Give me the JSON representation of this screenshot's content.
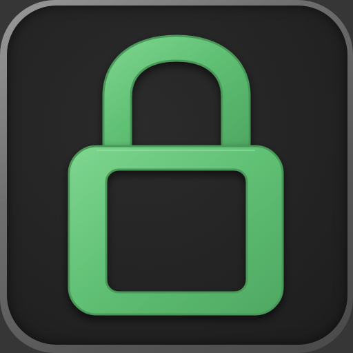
{
  "app_icon": {
    "name": "lock-app-icon",
    "glyph": "padlock-icon",
    "colors": {
      "tile_frame": "#7a7a7a",
      "tile_face": "#232323",
      "lock_fill": "#5fbf73",
      "lock_edge": "#4a9a5a",
      "lock_highlight": "#8fe0a0"
    }
  }
}
